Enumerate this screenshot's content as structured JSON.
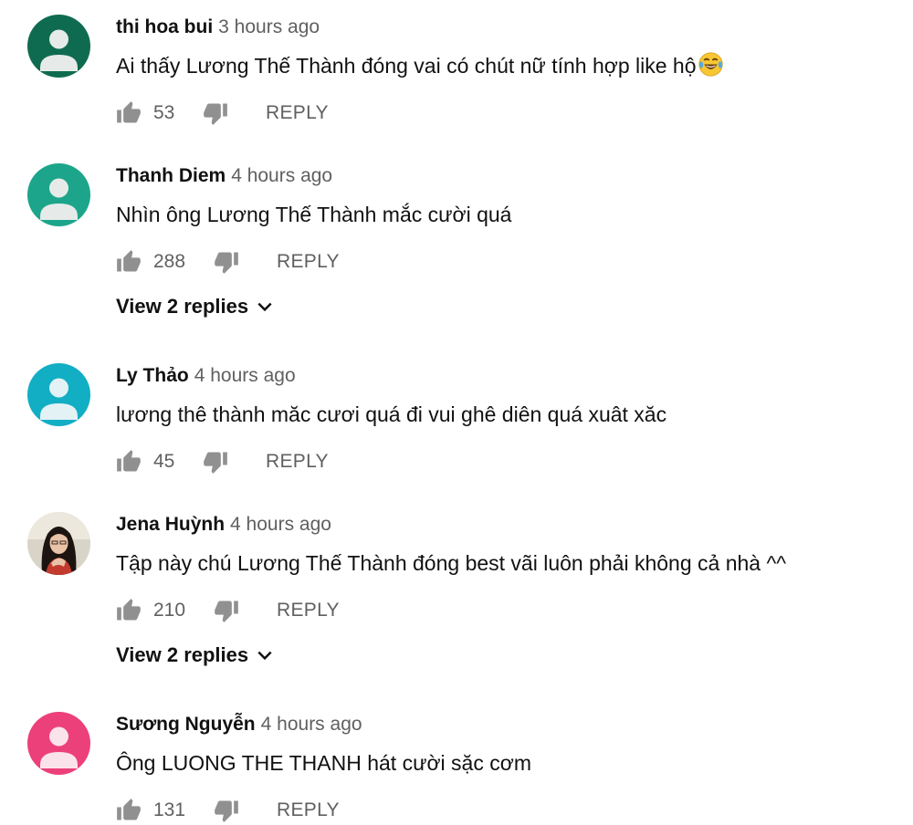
{
  "comments": [
    {
      "author": "thi hoa bui",
      "time": "3 hours ago",
      "text": "Ai thấy Lương Thế Thành đóng vai có chút nữ tính hợp like hộ",
      "emoji": "face-with-tears-of-joy-icon",
      "likes": "53",
      "reply_label": "REPLY",
      "avatar_color": "#0f6b4f",
      "avatar_type": "default"
    },
    {
      "author": "Thanh Diem",
      "time": "4 hours ago",
      "text": "Nhìn ông Lương Thế Thành mắc cười quá",
      "likes": "288",
      "reply_label": "REPLY",
      "view_replies": "View 2 replies",
      "avatar_color": "#1ca58a",
      "avatar_type": "default"
    },
    {
      "author": "Ly Thảo",
      "time": "4 hours ago",
      "text": "lương thê thành măc cươi quá đi vui ghê diên quá xuât xăc",
      "likes": "45",
      "reply_label": "REPLY",
      "avatar_color": "#12aec4",
      "avatar_type": "default"
    },
    {
      "author": "Jena Huỳnh",
      "time": "4 hours ago",
      "text": "Tập này chú Lương Thế Thành đóng best vãi luôn phải không cả nhà ^^",
      "likes": "210",
      "reply_label": "REPLY",
      "view_replies": "View 2 replies",
      "avatar_type": "photo"
    },
    {
      "author": "Sương Nguyễn",
      "time": "4 hours ago",
      "text": "Ông LUONG THE THANH hát cười sặc cơm",
      "likes": "131",
      "reply_label": "REPLY",
      "avatar_color": "#ec407a",
      "avatar_type": "default"
    }
  ],
  "icons": {
    "like": "thumbs-up-icon",
    "dislike": "thumbs-down-icon",
    "expand": "chevron-down-icon"
  },
  "colors": {
    "secondary_text": "#606060",
    "primary_text": "#111111",
    "icon": "#909090"
  }
}
